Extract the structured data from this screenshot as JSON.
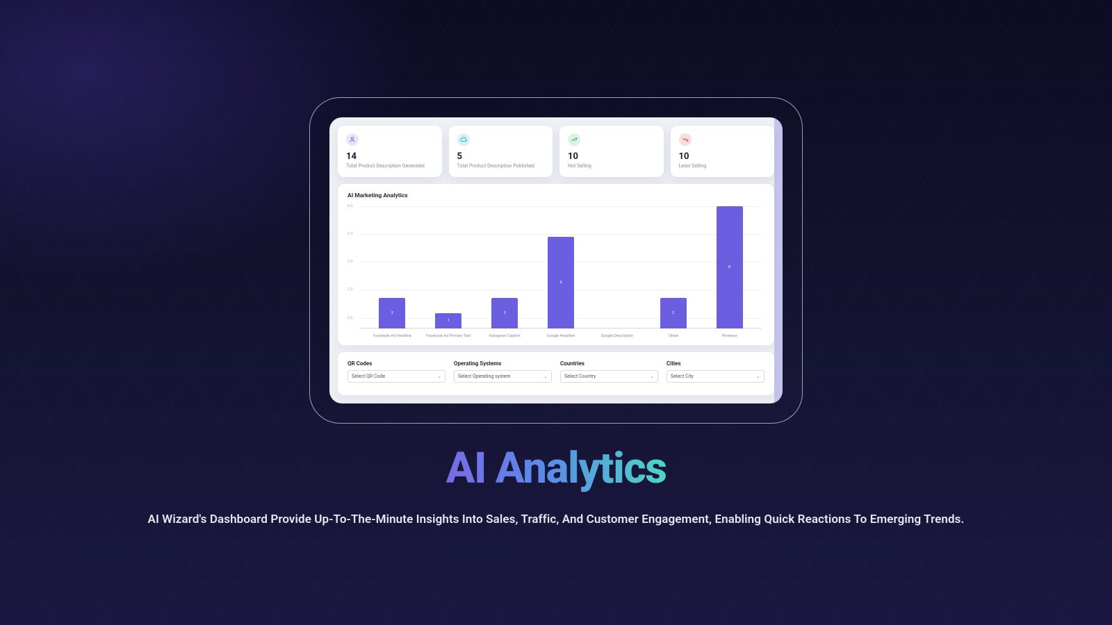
{
  "stats": [
    {
      "icon": "user",
      "color": "purple",
      "value": "14",
      "label": "Total Product Description Generated"
    },
    {
      "icon": "cloud",
      "color": "teal",
      "value": "5",
      "label": "Total Product Description Published"
    },
    {
      "icon": "trend-up",
      "color": "green",
      "value": "10",
      "label": "Hot Selling"
    },
    {
      "icon": "trend-down",
      "color": "red",
      "value": "10",
      "label": "Least Selling"
    }
  ],
  "chart_title": "AI Marketing Analytics",
  "chart_data": {
    "type": "bar",
    "categories": [
      "Facebook Ad Headline",
      "Facebook Ad Primary Text",
      "Instagram Caption",
      "Google Headline",
      "Google Description",
      "Tiktok",
      "Pinterest"
    ],
    "values": [
      2,
      1,
      2,
      6,
      0,
      2,
      8
    ],
    "title": "AI Marketing Analytics",
    "xlabel": "",
    "ylabel": "",
    "ylim": [
      0,
      8
    ],
    "y_ticks": [
      0.0,
      2.0,
      4.0,
      6.0,
      8.0
    ]
  },
  "filters": [
    {
      "label": "QR Codes",
      "placeholder": "Select QR Code"
    },
    {
      "label": "Operating Systems",
      "placeholder": "Select Operating system"
    },
    {
      "label": "Countries",
      "placeholder": "Select Country"
    },
    {
      "label": "Cities",
      "placeholder": "Select City"
    }
  ],
  "hero": {
    "title": "AI Analytics",
    "subtitle": "AI Wizard's Dashboard Provide Up-To-The-Minute Insights Into Sales, Traffic, And Customer Engagement, Enabling Quick Reactions To Emerging Trends."
  }
}
